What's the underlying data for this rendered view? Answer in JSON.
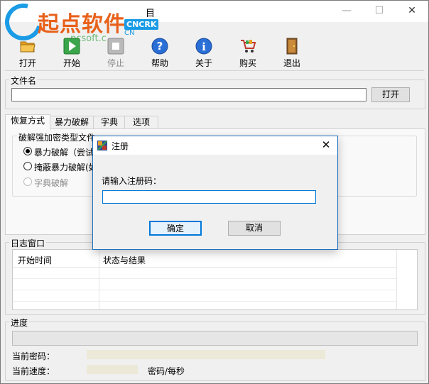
{
  "window": {
    "title_fragment": "目",
    "controls": {
      "minimize": "—",
      "maximize": "☐",
      "close": "✕"
    }
  },
  "watermark": {
    "text": "起点软件",
    "badge": "CNCRK",
    "sub": "CN",
    "url_fragment": "pcsoft.c",
    "brand_color": "#e8611b",
    "accent_color": "#1a9be6"
  },
  "toolbar": {
    "open": "打开",
    "start": "开始",
    "stop": "停止",
    "help": "帮助",
    "about": "关于",
    "buy": "购买",
    "exit": "退出"
  },
  "filename": {
    "label": "文件名",
    "value": "",
    "open_button": "打开"
  },
  "tabs": [
    "恢复方式",
    "暴力破解",
    "字典",
    "选项"
  ],
  "recovery": {
    "group_label": "破解强加密类型文件",
    "options": [
      {
        "label": "暴力破解（尝试",
        "checked": true,
        "enabled": true
      },
      {
        "label": "掩蔽暴力破解(如",
        "checked": false,
        "enabled": true
      },
      {
        "label": "字典破解",
        "checked": false,
        "enabled": false
      }
    ]
  },
  "log": {
    "label": "日志窗口",
    "columns": [
      "开始时间",
      "状态与结果"
    ]
  },
  "progress": {
    "label": "进度",
    "value": 0
  },
  "status": {
    "current_password_label": "当前密码：",
    "current_speed_label": "当前速度：",
    "speed_unit": "密码/每秒"
  },
  "dialog": {
    "title": "注册",
    "close": "✕",
    "prompt": "请输入注册码：",
    "input_value": "",
    "ok": "确定",
    "cancel": "取消"
  }
}
